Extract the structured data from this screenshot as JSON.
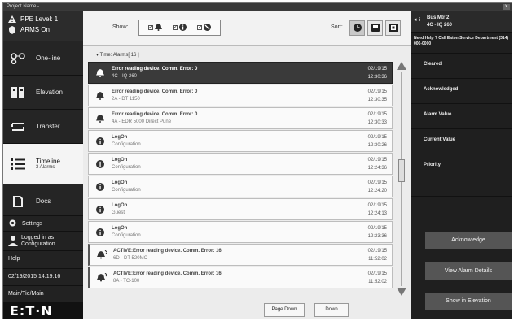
{
  "window": {
    "title": "Project Name -",
    "close": "x"
  },
  "ppe": {
    "level": "PPE Level: 1",
    "arms": "ARMS On"
  },
  "nav": [
    {
      "label": "One-line",
      "icon": "one-line-icon"
    },
    {
      "label": "Elevation",
      "icon": "elevation-icon"
    },
    {
      "label": "Transfer",
      "icon": "transfer-icon"
    },
    {
      "label": "Timeline",
      "sub": "3 Alarms",
      "icon": "timeline-icon"
    },
    {
      "label": "Docs",
      "icon": "docs-icon"
    }
  ],
  "sidebar": {
    "settings": "Settings",
    "login_line1": "Logged in as",
    "login_line2": "Configuration",
    "help": "Help",
    "datetime": "02/19/2015 14:19:16",
    "location": "Main/Tie/Main",
    "logo": "E:T·N"
  },
  "toolbar": {
    "show_label": "Show:",
    "sort_label": "Sort:"
  },
  "group": {
    "header": "Time: Alarms[ 16 ]"
  },
  "events": [
    {
      "type": "bell",
      "title": "Error reading device. Comm. Error: 0",
      "sub": "4C - IQ 260",
      "date": "02/19/15",
      "time": "12:30:36",
      "selected": true
    },
    {
      "type": "bell",
      "title": "Error reading device. Comm. Error: 0",
      "sub": "2A - DT 1150",
      "date": "02/19/15",
      "time": "12:30:35"
    },
    {
      "type": "bell",
      "title": "Error reading device. Comm. Error: 0",
      "sub": "4A - EDR 5000 Direct Pune",
      "date": "02/19/15",
      "time": "12:30:33"
    },
    {
      "type": "info",
      "title": "LogOn",
      "sub": "Configuration",
      "date": "02/19/15",
      "time": "12:30:26"
    },
    {
      "type": "info",
      "title": "LogOn",
      "sub": "Configuration",
      "date": "02/19/15",
      "time": "12:24:36"
    },
    {
      "type": "info",
      "title": "LogOn",
      "sub": "Configuration",
      "date": "02/19/15",
      "time": "12:24:20"
    },
    {
      "type": "info",
      "title": "LogOn",
      "sub": "Guest",
      "date": "02/19/15",
      "time": "12:24:13"
    },
    {
      "type": "info",
      "title": "LogOn",
      "sub": "Configuration",
      "date": "02/19/15",
      "time": "12:23:36"
    },
    {
      "type": "active",
      "title": "ACTIVE:Error reading device. Comm. Error: 16",
      "sub": "6D - DT 520MC",
      "date": "02/19/15",
      "time": "11:52:02"
    },
    {
      "type": "active",
      "title": "ACTIVE:Error reading device. Comm. Error: 16",
      "sub": "8A - TC-100",
      "date": "02/19/15",
      "time": "11:52:02"
    }
  ],
  "paging": {
    "page_down": "Page Down",
    "down": "Down"
  },
  "device": {
    "name": "Bus Mtr 2",
    "id": "4C - IQ 260"
  },
  "help_text": "Need Help ? Call Eaton Service Department (314) 000-0000",
  "details": [
    "Cleared",
    "Acknowledged",
    "Alarm Value",
    "Current Value",
    "Priority"
  ],
  "actions": {
    "acknowledge": "Acknowledge",
    "view_details": "View Alarm Details",
    "show_elevation": "Show in Elevation"
  }
}
